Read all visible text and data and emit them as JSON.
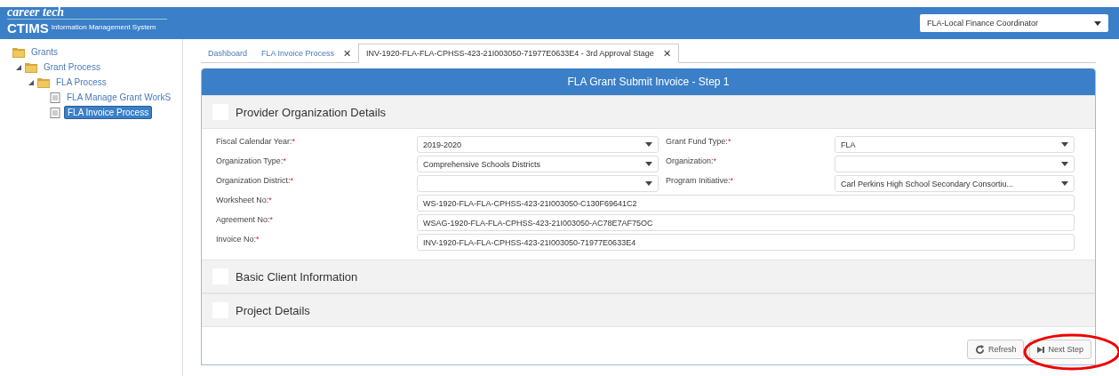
{
  "header": {
    "brand": "career tech",
    "app_name": "CTIMS",
    "app_subtitle": "Information Management System",
    "role_select": {
      "value": "FLA-Local Finance Coordinator"
    }
  },
  "sidebar": {
    "tree": [
      {
        "label": "Grants",
        "kind": "folder",
        "selected": false,
        "children": [
          {
            "label": "Grant Process",
            "kind": "folder",
            "expanded": true,
            "selected": false,
            "children": [
              {
                "label": "FLA Process",
                "kind": "folder",
                "expanded": true,
                "selected": false,
                "children": [
                  {
                    "label": "FLA Manage Grant WorkS",
                    "kind": "page",
                    "selected": false
                  },
                  {
                    "label": "FLA Invoice Process",
                    "kind": "page",
                    "selected": true
                  }
                ]
              }
            ]
          }
        ]
      }
    ]
  },
  "tabs": [
    {
      "label": "Dashboard",
      "selected": false
    },
    {
      "label": "FLA Invoice Process",
      "close": "✕",
      "selected": false
    },
    {
      "label": "INV-1920-FLA-FLA-CPHSS-423-21I003050-71977E0633E4 - 3rd Approval Stage",
      "close": "✕",
      "selected": true
    }
  ],
  "panel": {
    "title": "FLA Grant Submit Invoice - Step 1",
    "sections": [
      {
        "title": "Provider Organization Details",
        "fields": [
          {
            "label": "Fiscal Calendar Year:",
            "mark": "*",
            "kind": "select",
            "value": "2019-2020"
          },
          {
            "label": "Grant Fund Type:",
            "mark": "*",
            "kind": "select",
            "value": "FLA"
          },
          {
            "label": "Organization Type:",
            "mark": "*",
            "kind": "select",
            "value": "Comprehensive Schools Districts"
          },
          {
            "label": "Organization:",
            "mark": "*",
            "kind": "select"
          },
          {
            "label": "Organization District:",
            "mark": "*",
            "kind": "select"
          },
          {
            "label": "Program Initiative:",
            "mark": "*",
            "kind": "select",
            "value": "Carl Perkins High School Secondary Consortiu..."
          },
          {
            "label": "Worksheet No:",
            "mark": "*",
            "kind": "text",
            "value": "WS-1920-FLA-FLA-CPHSS-423-21I003050-C130F69641C2"
          },
          {
            "label": "Agreement No:",
            "mark": "*",
            "kind": "text",
            "value": "WSAG-1920-FLA-FLA-CPHSS-423-21I003050-AC78E7AF75OC"
          },
          {
            "label": "Invoice No:",
            "mark": "*",
            "kind": "text",
            "value": "INV-1920-FLA-FLA-CPHSS-423-21I003050-71977E0633E4"
          }
        ]
      },
      {
        "title": "Basic Client Information"
      },
      {
        "title": "Project Details"
      }
    ],
    "buttons": [
      {
        "label": "Refresh",
        "kind": "refresh",
        "highlighted": false
      },
      {
        "label": "Next Step",
        "kind": "next",
        "highlighted": true
      }
    ]
  }
}
